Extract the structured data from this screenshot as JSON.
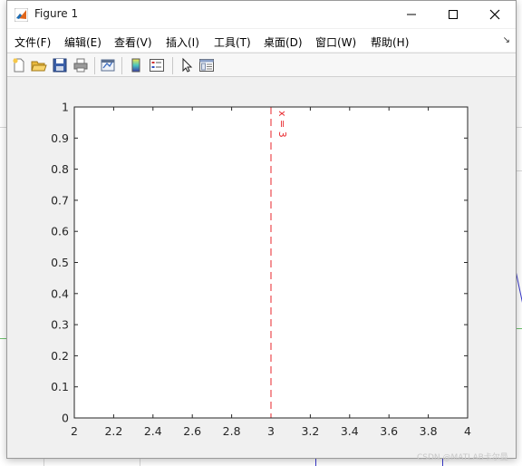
{
  "window": {
    "title": "Figure 1"
  },
  "menu": {
    "items": [
      {
        "label": "文件(F)"
      },
      {
        "label": "编辑(E)"
      },
      {
        "label": "查看(V)"
      },
      {
        "label": "插入(I)"
      },
      {
        "label": "工具(T)"
      },
      {
        "label": "桌面(D)"
      },
      {
        "label": "窗口(W)"
      },
      {
        "label": "帮助(H)"
      }
    ],
    "overflow_arrow": "↘"
  },
  "toolbar": {
    "buttons": [
      {
        "icon": "new-figure-icon"
      },
      {
        "icon": "open-file-icon"
      },
      {
        "icon": "save-icon"
      },
      {
        "icon": "print-icon"
      },
      {
        "icon": "link-plot-icon"
      },
      {
        "icon": "colorbar-icon"
      },
      {
        "icon": "legend-icon"
      },
      {
        "icon": "edit-plot-arrow-icon"
      },
      {
        "icon": "property-inspector-icon"
      }
    ]
  },
  "colors": {
    "xline": "#e8262b",
    "axes_bg": "#ffffff",
    "figure_bg": "#f0f0f0"
  },
  "chart_data": {
    "type": "line",
    "title": "",
    "xlabel": "",
    "ylabel": "",
    "xlim": [
      2,
      4
    ],
    "ylim": [
      0,
      1
    ],
    "x_ticks": [
      "2",
      "2.2",
      "2.4",
      "2.6",
      "2.8",
      "3",
      "3.2",
      "3.4",
      "3.6",
      "3.8",
      "4"
    ],
    "y_ticks": [
      "0",
      "0.1",
      "0.2",
      "0.3",
      "0.4",
      "0.5",
      "0.6",
      "0.7",
      "0.8",
      "0.9",
      "1"
    ],
    "grid": false,
    "xlines": [
      {
        "x": 3,
        "label": "x = 3",
        "style": "dashed",
        "color": "#e8262b"
      }
    ],
    "series": []
  },
  "watermark": "CSDN @MATLAB卡尔曼"
}
